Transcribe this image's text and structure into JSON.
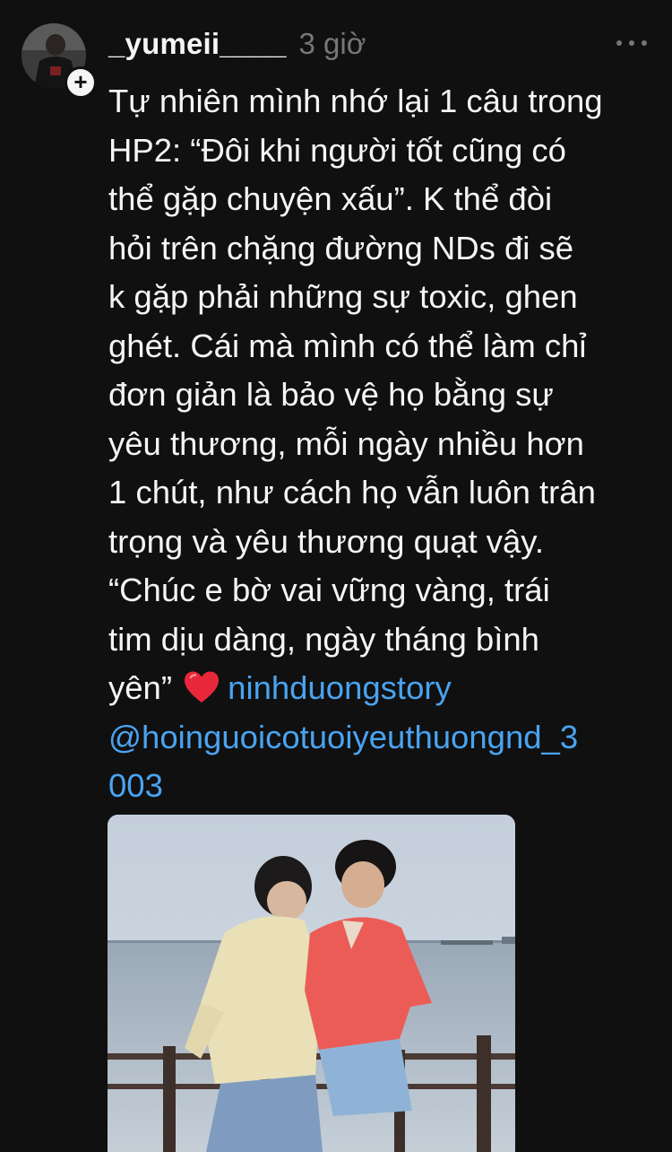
{
  "post": {
    "author": {
      "username": "_yumeii____",
      "time": "3 giờ"
    },
    "caption": {
      "lines": [
        "Tự nhiên mình nhớ lại 1 câu trong",
        "HP2: “Đôi khi người tốt cũng có",
        "thể gặp chuyện xấu”. K thể đòi",
        "hỏi trên chặng đường NDs đi sẽ",
        "k gặp phải những sự toxic, ghen",
        "ghét. Cái mà mình có thể làm chỉ",
        "đơn giản là bảo vệ họ bằng sự",
        "yêu thương, mỗi ngày nhiều hơn",
        "1 chút, như cách họ vẫn luôn trân",
        "trọng và yêu thương quạt vậy.",
        "“Chúc e bờ vai vững vàng, trái",
        "tim dịu dàng, ngày tháng bình"
      ],
      "last_line_text": "yên”",
      "emoji": "heart-emoji",
      "hashtag": "ninhduongstory",
      "mention_line1": "@hoinguoicotuoiyeuthuongnd_3",
      "mention_line2": "003"
    },
    "icons": {
      "more": "more-horizontal-icon",
      "follow": "plus-icon"
    },
    "colors": {
      "background": "#101010",
      "text": "#f3f5f7",
      "muted": "#777777",
      "link": "#4aa3f0",
      "heart": "#e8283a"
    }
  }
}
